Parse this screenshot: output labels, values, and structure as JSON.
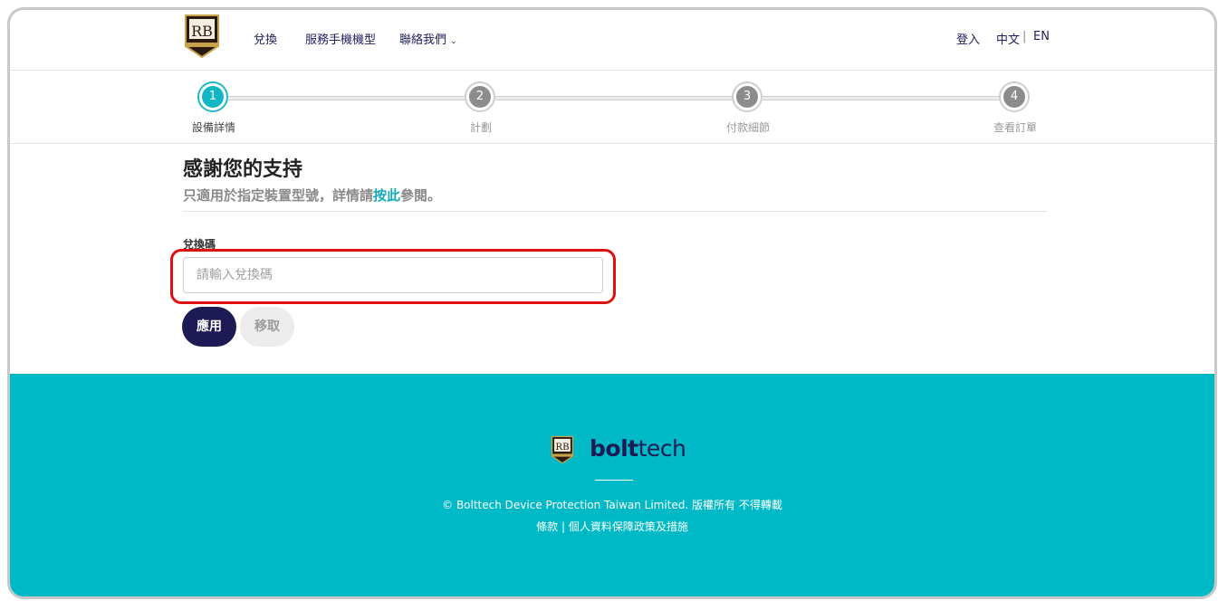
{
  "header": {
    "nav": [
      "兌換",
      "服務手機機型",
      "聯絡我們"
    ],
    "login": "登入",
    "lang_zh": "中文",
    "lang_sep": "|",
    "lang_en": "EN",
    "logo_text": "RB"
  },
  "stepper": {
    "steps": [
      {
        "number": "1",
        "label": "設備詳情",
        "active": true
      },
      {
        "number": "2",
        "label": "計劃",
        "active": false
      },
      {
        "number": "3",
        "label": "付款細節",
        "active": false
      },
      {
        "number": "4",
        "label": "查看訂單",
        "active": false
      }
    ]
  },
  "main": {
    "title": "感謝您的支持",
    "subtitle_before": "只適用於指定裝置型號，詳情請",
    "subtitle_link": "按此",
    "subtitle_after": "參閱。",
    "field_label": "兌換碼",
    "input_value": "",
    "input_placeholder": "請輸入兌換碼",
    "apply_label": "應用",
    "remove_label": "移取"
  },
  "footer": {
    "brand_bold": "bolt",
    "brand_light": "tech",
    "copyright": "© Bolttech Device Protection Taiwan Limited. 版權所有 不得轉載",
    "link_terms": "條款",
    "link_sep": " | ",
    "link_privacy": "個人資料保障政策及措施"
  },
  "colors": {
    "accent": "#13b6c4",
    "primary": "#1d1a55",
    "highlight": "#e01010",
    "footer_bg": "#00b9c6"
  }
}
